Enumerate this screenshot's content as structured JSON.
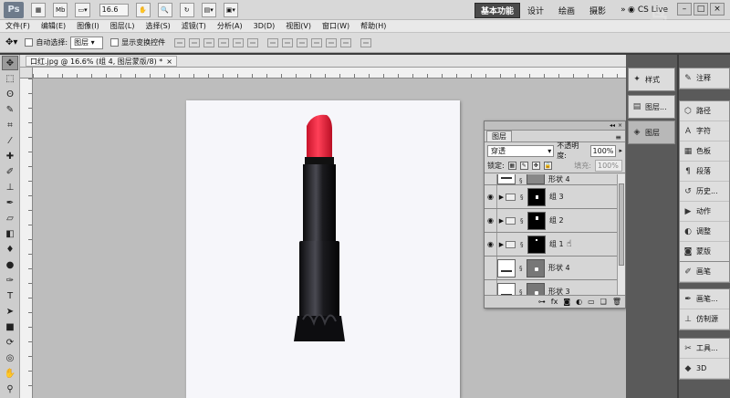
{
  "app": {
    "logo": "Ps",
    "zoom": "16.6"
  },
  "workspaces": {
    "active": "基本功能",
    "items": [
      "设计",
      "绘画",
      "摄影"
    ],
    "more": "»"
  },
  "cslive": "CS Live",
  "menu": [
    "文件(F)",
    "编辑(E)",
    "图像(I)",
    "图层(L)",
    "选择(S)",
    "滤镜(T)",
    "分析(A)",
    "3D(D)",
    "视图(V)",
    "窗口(W)",
    "帮助(H)"
  ],
  "options": {
    "auto_select_label": "自动选择:",
    "auto_select_value": "图层",
    "show_transform_label": "显示变换控件"
  },
  "document": {
    "tab_title": "口红.jpg @ 16.6% (组 4, 图层蒙版/8) *",
    "close": "×"
  },
  "layers_panel": {
    "tab": "图层",
    "blend_mode": "穿透",
    "opacity_label": "不透明度:",
    "opacity": "100%",
    "lock_label": "锁定:",
    "fill_label": "填充:",
    "fill": "100%",
    "layers": [
      {
        "name": "形状 4",
        "type": "shape",
        "visible": true,
        "partial": true
      },
      {
        "name": "组 3",
        "type": "group",
        "visible": true
      },
      {
        "name": "组 2",
        "type": "group",
        "visible": true
      },
      {
        "name": "组 1",
        "type": "group",
        "visible": true
      },
      {
        "name": "形状 4",
        "type": "shape",
        "visible": false
      },
      {
        "name": "形状 3",
        "type": "shape",
        "visible": false
      }
    ],
    "bottom_icons": [
      "link-icon",
      "fx-icon",
      "mask-icon",
      "adjustment-icon",
      "folder-icon",
      "new-layer-icon",
      "trash-icon"
    ]
  },
  "dock_mid": [
    {
      "label": "样式",
      "icon": "style-icon"
    },
    {
      "label": "图层...",
      "icon": "layers-icon"
    },
    {
      "label": "图层",
      "icon": "layers-stack-icon"
    }
  ],
  "dock_right_groups": [
    [
      {
        "label": "注释",
        "icon": "note-icon"
      }
    ],
    [
      {
        "label": "路径",
        "icon": "path-icon"
      },
      {
        "label": "字符",
        "icon": "character-icon"
      },
      {
        "label": "色板",
        "icon": "swatches-icon"
      },
      {
        "label": "段落",
        "icon": "paragraph-icon"
      },
      {
        "label": "历史...",
        "icon": "history-icon"
      },
      {
        "label": "动作",
        "icon": "actions-icon"
      },
      {
        "label": "调整",
        "icon": "adjustments-icon"
      },
      {
        "label": "蒙版",
        "icon": "masks-icon"
      }
    ],
    [
      {
        "label": "画笔",
        "icon": "brush-icon"
      }
    ],
    [
      {
        "label": "画笔...",
        "icon": "brush-presets-icon"
      },
      {
        "label": "仿制源",
        "icon": "clone-source-icon"
      }
    ],
    [
      {
        "label": "工具...",
        "icon": "tool-presets-icon"
      },
      {
        "label": "3D",
        "icon": "3d-icon"
      }
    ]
  ],
  "tools": [
    "move-tool-icon",
    "marquee-tool-icon",
    "lasso-tool-icon",
    "quick-select-tool-icon",
    "crop-tool-icon",
    "eyedropper-tool-icon",
    "healing-tool-icon",
    "brush-tool-icon",
    "clone-tool-icon",
    "history-brush-tool-icon",
    "eraser-tool-icon",
    "gradient-tool-icon",
    "blur-tool-icon",
    "dodge-tool-icon",
    "pen-tool-icon",
    "type-tool-icon",
    "path-select-tool-icon",
    "shape-tool-icon",
    "3d-rotate-tool-icon",
    "3d-orbit-tool-icon",
    "hand-tool-icon",
    "zoom-tool-icon"
  ]
}
